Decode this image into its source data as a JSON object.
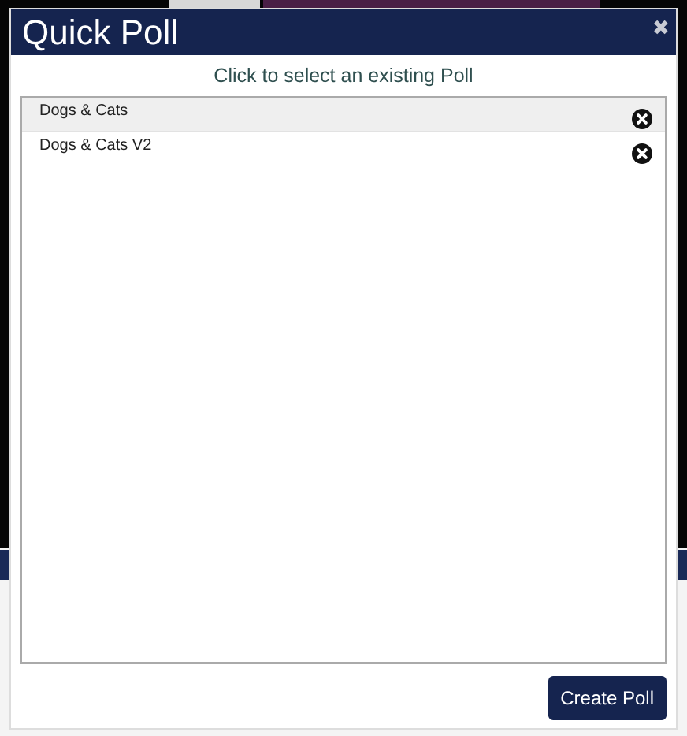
{
  "dialog": {
    "title": "Quick Poll",
    "close_label": "✖",
    "prompt": "Click to select an existing Poll",
    "polls": [
      {
        "name": "Dogs & Cats",
        "selected": true
      },
      {
        "name": "Dogs & Cats V2",
        "selected": false
      }
    ],
    "create_button": "Create Poll"
  }
}
